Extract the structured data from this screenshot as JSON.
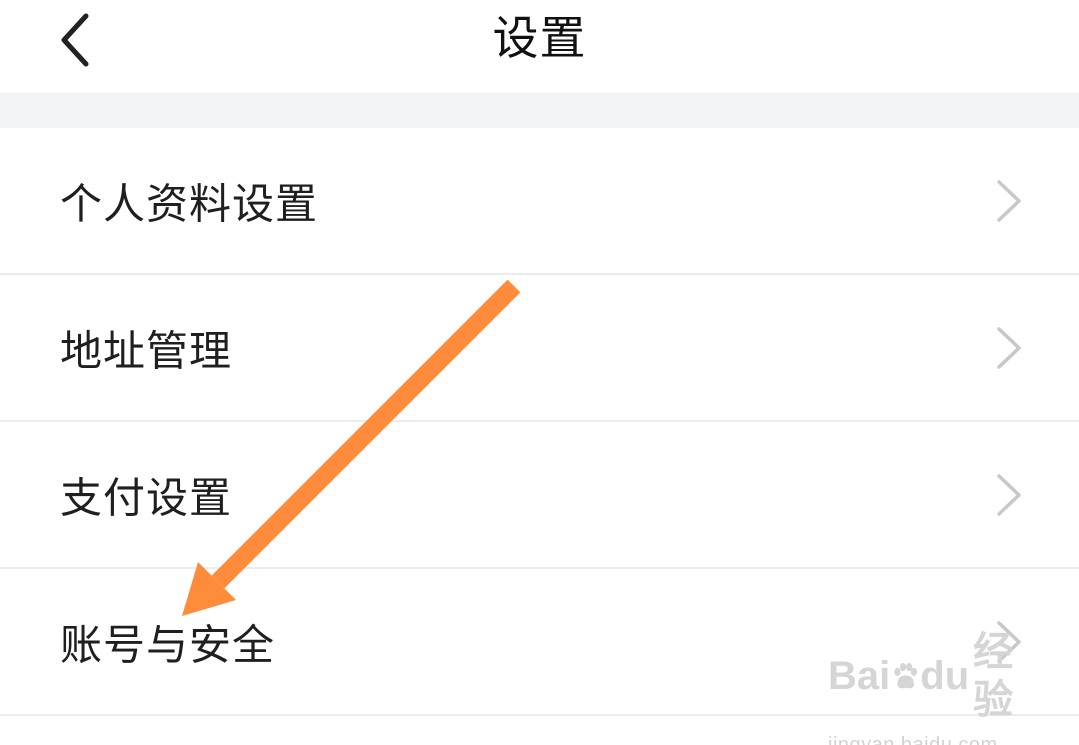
{
  "header": {
    "title": "设置",
    "back_icon": "chevron-left-icon"
  },
  "settings": {
    "items": [
      {
        "label": "个人资料设置",
        "icon": "chevron-right-icon"
      },
      {
        "label": "地址管理",
        "icon": "chevron-right-icon"
      },
      {
        "label": "支付设置",
        "icon": "chevron-right-icon"
      },
      {
        "label": "账号与安全",
        "icon": "chevron-right-icon"
      }
    ]
  },
  "annotation": {
    "type": "arrow",
    "color": "#ff8c3a",
    "target": "账号与安全"
  },
  "watermark": {
    "brand_left": "Bai",
    "brand_right": "du",
    "brand_cn": "经验",
    "url": "jingyan.baidu.com"
  },
  "colors": {
    "background": "#ffffff",
    "section_gap": "#f3f4f7",
    "divider": "#ececee",
    "text": "#1f1f1f",
    "chevron": "#c8c8cc"
  }
}
